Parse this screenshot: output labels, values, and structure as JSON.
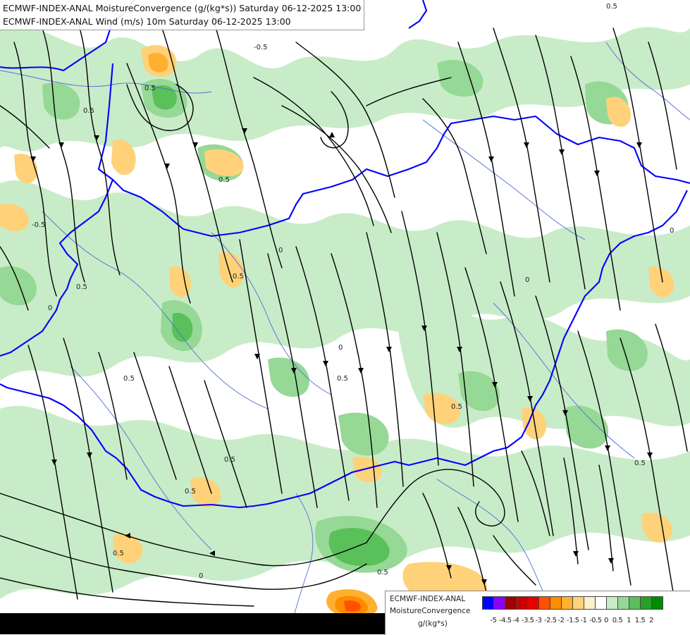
{
  "titles": {
    "line1": "ECMWF-INDEX-ANAL MoistureConvergence (g/(kg*s)) Saturday 06-12-2025 13:00",
    "line2": "ECMWF-INDEX-ANAL Wind (m/s) 10m Saturday 06-12-2025 13:00"
  },
  "legend": {
    "line1": "ECMWF-INDEX-ANAL",
    "line2": "MoistureConvergence",
    "line3": "g/(kg*s)",
    "colors": [
      "#0000ff",
      "#8a00ff",
      "#a00000",
      "#c80000",
      "#e60000",
      "#ff5000",
      "#ff8c00",
      "#ffb030",
      "#ffd27a",
      "#fff0c8",
      "#ffffff",
      "#c8ecc8",
      "#96d896",
      "#5ac05a",
      "#28a028",
      "#008c00"
    ],
    "ticks": [
      "-5",
      "-4.5",
      "-4",
      "-3.5",
      "-3",
      "-2.5",
      "-2",
      "-1.5",
      "-1",
      "-0.5",
      "0",
      "0.5",
      "1",
      "1.5",
      "2"
    ]
  },
  "contour_labels": [
    "0",
    "0.5",
    "-0.5"
  ],
  "map_style": {
    "border_color": "#0000ff",
    "river_color": "#4f6fd6",
    "streamline_color": "#000000",
    "bottom_band_color": "#000000"
  }
}
